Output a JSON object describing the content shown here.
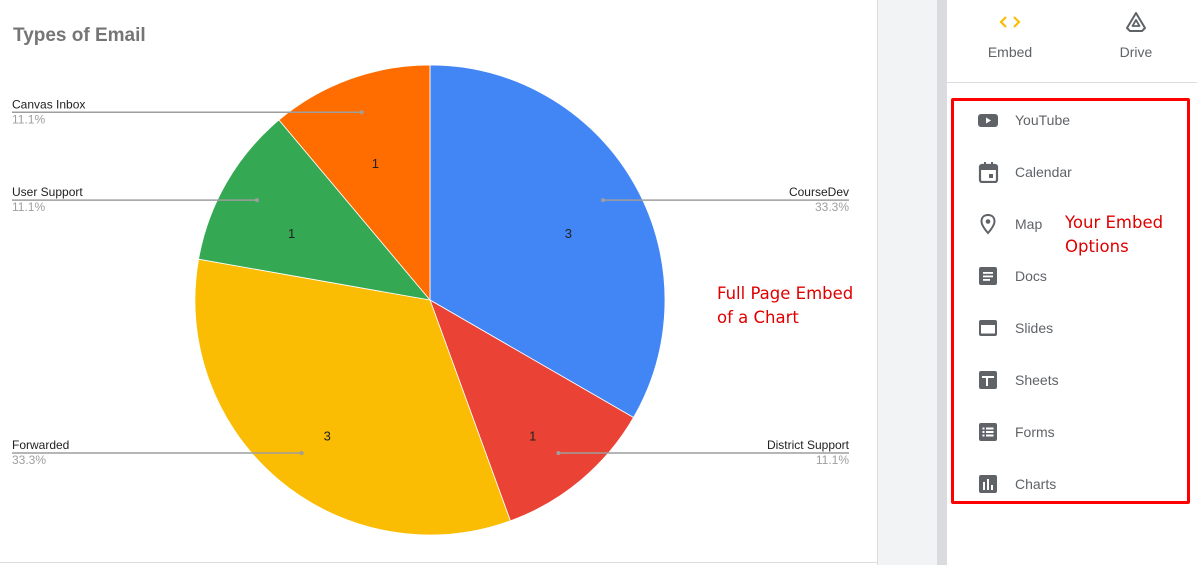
{
  "chart_data": {
    "type": "pie",
    "title": "Types of Email",
    "categories": [
      "CourseDev",
      "District Support",
      "Forwarded",
      "User Support",
      "Canvas Inbox"
    ],
    "values": [
      3,
      1,
      3,
      1,
      1
    ],
    "percent_labels": [
      "33.3%",
      "11.1%",
      "33.3%",
      "11.1%",
      "11.1%"
    ],
    "value_labels": [
      "3",
      "1",
      "3",
      "1",
      "1"
    ],
    "colors": [
      "#4285f4",
      "#ea4335",
      "#fbbc04",
      "#34a853",
      "#ff6d01"
    ],
    "start_angle_deg": 0,
    "direction": "clockwise",
    "legend": "labeled"
  },
  "annotations": {
    "chart_note_line1": "Full Page Embed",
    "chart_note_line2": "of a Chart",
    "options_note_line1": "Your Embed",
    "options_note_line2": "Options"
  },
  "panel": {
    "tabs": [
      {
        "label": "Embed",
        "icon": "code-icon",
        "color": "#fbbc04"
      },
      {
        "label": "Drive",
        "icon": "drive-icon",
        "color": "#5f6368"
      }
    ],
    "options": [
      {
        "label": "YouTube",
        "icon": "youtube-icon"
      },
      {
        "label": "Calendar",
        "icon": "calendar-icon"
      },
      {
        "label": "Map",
        "icon": "map-pin-icon"
      },
      {
        "label": "Docs",
        "icon": "docs-icon"
      },
      {
        "label": "Slides",
        "icon": "slides-icon"
      },
      {
        "label": "Sheets",
        "icon": "sheets-icon"
      },
      {
        "label": "Forms",
        "icon": "forms-icon"
      },
      {
        "label": "Charts",
        "icon": "charts-icon"
      }
    ]
  }
}
